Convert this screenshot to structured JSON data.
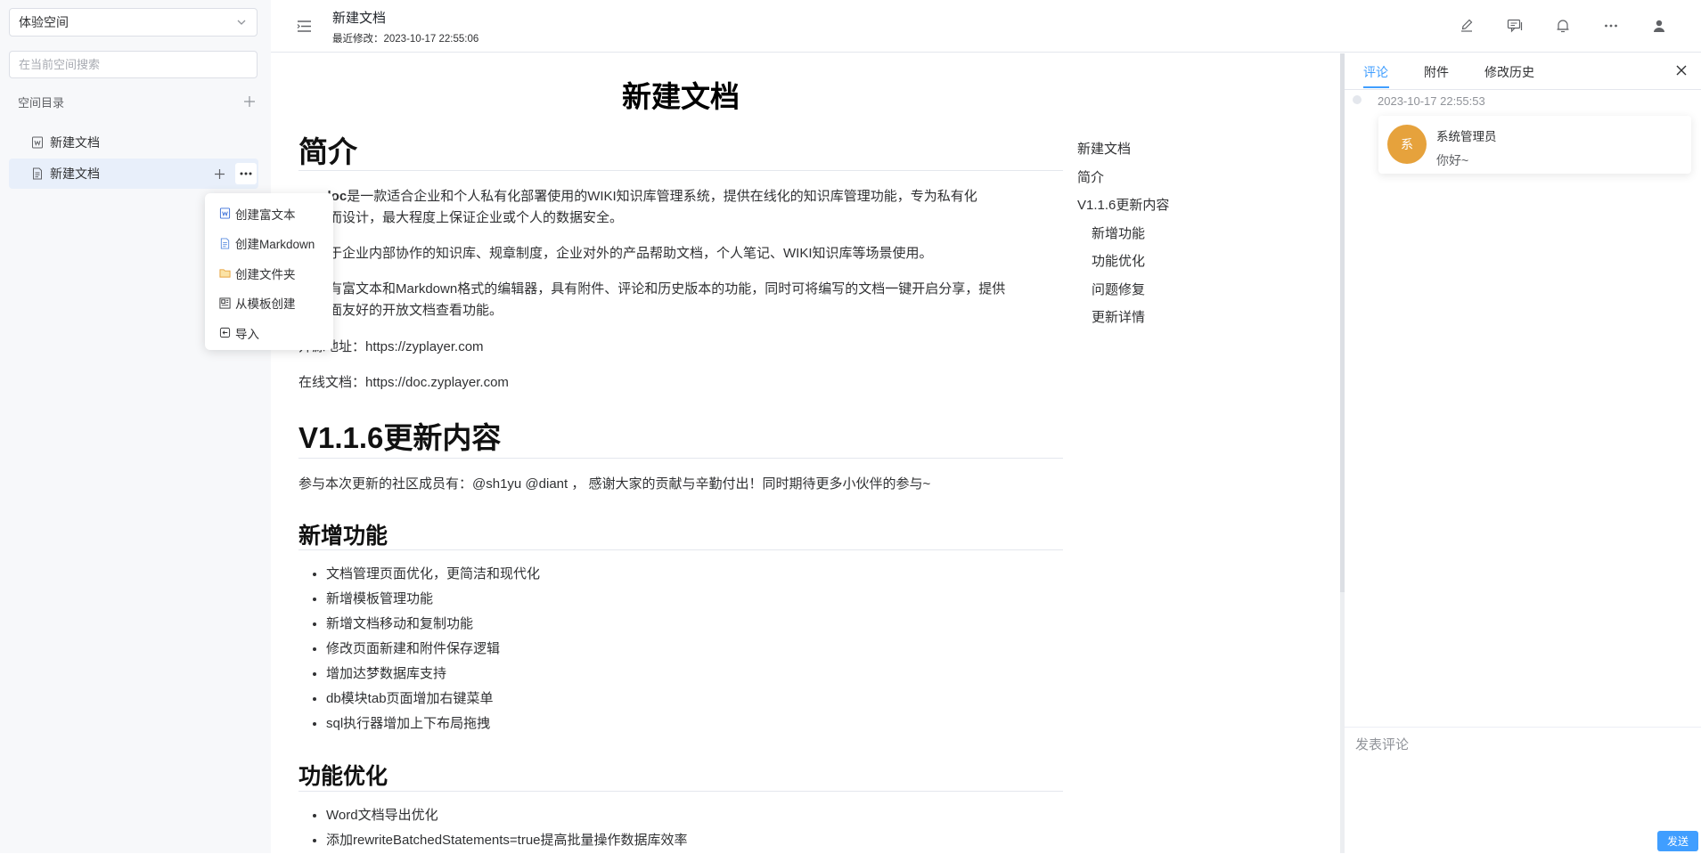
{
  "sidebar": {
    "space_select": "体验空间",
    "search_placeholder": "在当前空间搜索",
    "catalog_title": "空间目录",
    "items": [
      {
        "label": "新建文档",
        "icon": "word-doc-icon"
      },
      {
        "label": "新建文档",
        "icon": "document-icon"
      }
    ]
  },
  "context_menu": {
    "items": [
      {
        "label": "创建富文本",
        "icon": "word-doc-icon"
      },
      {
        "label": "创建Markdown",
        "icon": "markdown-doc-icon"
      },
      {
        "label": "创建文件夹",
        "icon": "folder-icon"
      },
      {
        "label": "从模板创建",
        "icon": "template-icon"
      },
      {
        "label": "导入",
        "icon": "import-icon"
      }
    ]
  },
  "header": {
    "title": "新建文档",
    "modified": "最近修改：2023-10-17 22:55:06",
    "icons": [
      "edit-icon",
      "comment-icon",
      "bell-icon",
      "more-icon",
      "user-icon"
    ]
  },
  "document": {
    "title": "新建文档",
    "intro_heading": "简介",
    "p1_bold": "yer-doc",
    "p1_rest": "是一款适合企业和个人私有化部署使用的WIKI知识库管理系统，提供在线化的知识库管理功能，专为私有化",
    "p1_line2": "而设计，最大程度上保证企业或个人的数据安全。",
    "p2": "于企业内部协作的知识库、规章制度，企业对外的产品帮助文档，个人笔记、WIKI知识库等场景使用。",
    "p3_line1": "有富文本和Markdown格式的编辑器，具有附件、评论和历史版本的功能，同时可将编写的文档一键开启分享，提供",
    "p3_line2": "面友好的开放文档查看功能。",
    "p4": "开源地址：https://zyplayer.com",
    "p5": "在线文档：https://doc.zyplayer.com",
    "update_heading": "V1.1.6更新内容",
    "contributors": "参与本次更新的社区成员有：@sh1yu @diant ， 感谢大家的贡献与辛勤付出！同时期待更多小伙伴的参与~",
    "new_features_heading": "新增功能",
    "new_features": [
      "文档管理页面优化，更简洁和现代化",
      "新增模板管理功能",
      "新增文档移动和复制功能",
      "修改页面新建和附件保存逻辑",
      "增加达梦数据库支持",
      "db模块tab页面增加右键菜单",
      "sql执行器增加上下布局拖拽"
    ],
    "optimize_heading": "功能优化",
    "optimizations": [
      "Word文档导出优化",
      "添加rewriteBatchedStatements=true提高批量操作数据库效率"
    ]
  },
  "toc": [
    {
      "label": "新建文档",
      "level": 1
    },
    {
      "label": "简介",
      "level": 1
    },
    {
      "label": "V1.1.6更新内容",
      "level": 1
    },
    {
      "label": "新增功能",
      "level": 2
    },
    {
      "label": "功能优化",
      "level": 2
    },
    {
      "label": "问题修复",
      "level": 2
    },
    {
      "label": "更新详情",
      "level": 2
    }
  ],
  "right_panel": {
    "tabs": [
      "评论",
      "附件",
      "修改历史"
    ],
    "active_tab": "评论",
    "comment": {
      "time": "2023-10-17 22:55:53",
      "avatar_text": "系",
      "user": "系统管理员",
      "text": "你好~"
    },
    "input_placeholder": "发表评论",
    "send_label": "发送"
  },
  "colors": {
    "accent": "#409eff",
    "avatar": "#e6a23c",
    "sidebar_bg": "#f7f8fa",
    "active_item_bg": "#e8effa"
  }
}
